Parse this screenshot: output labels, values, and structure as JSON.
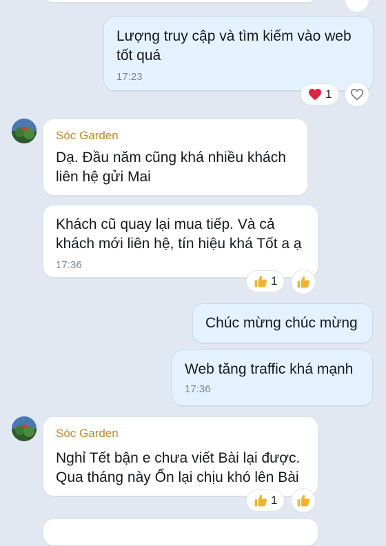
{
  "messages": [
    {
      "text": "Lượng truy cập và tìm kiếm vào web tốt quá",
      "time": "17:23",
      "reaction": {
        "icon": "heart-icon",
        "count": "1"
      }
    },
    {
      "sender": "Sóc Garden",
      "text": "Dạ. Đầu năm cũng khá nhiều khách liên hệ gửi Mai"
    },
    {
      "text": "Khách cũ quay lại mua tiếp. Và cả khách mới liên hệ, tín hiệu khá Tốt a ạ",
      "time": "17:36",
      "reaction": {
        "icon": "thumbs-up-icon",
        "count": "1"
      }
    },
    {
      "text": "Chúc mừng chúc mừng"
    },
    {
      "text": "Web tăng traffic khá mạnh",
      "time": "17:36"
    },
    {
      "sender": "Sóc Garden",
      "text": "Nghỉ Tết bận e chưa viết Bài lại được. Qua tháng này Ổn lại chịu khó lên Bài",
      "reaction": {
        "icon": "thumbs-up-icon",
        "count": "1"
      }
    }
  ],
  "colors": {
    "background": "#e2e8f1",
    "outgoing_bubble": "#e4f2ff",
    "incoming_bubble": "#ffffff",
    "sender_name": "#c08724",
    "heart": "#e0223c",
    "thumbs_up": "#f2b42a"
  },
  "icons": {
    "heart_outline": "heart-outline-icon",
    "thumbs_up": "thumbs-up-icon",
    "avatar": "avatar-image"
  }
}
